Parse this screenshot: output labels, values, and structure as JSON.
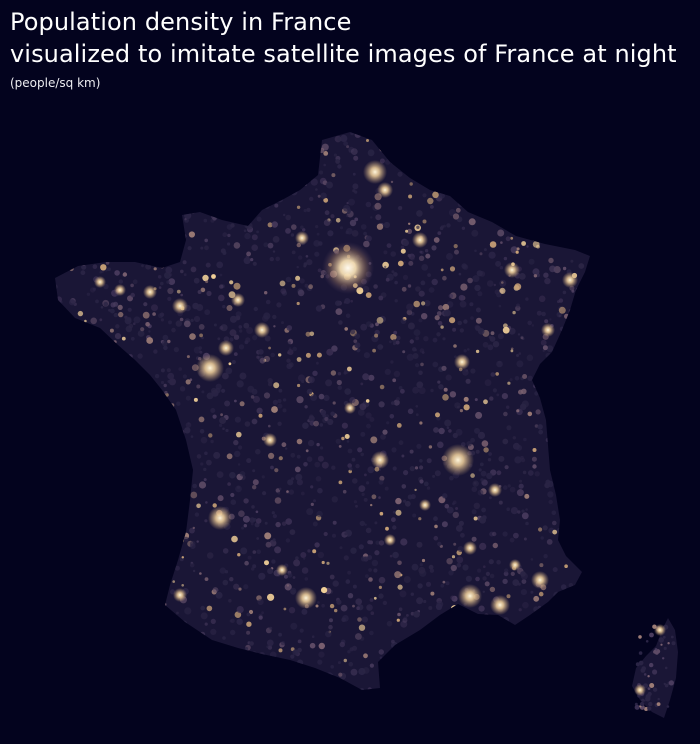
{
  "title": {
    "line1": "Population density in France",
    "line2": "visualized to imitate satellite images of France at night",
    "unit": "(people/sq km)"
  },
  "colors": {
    "background": "#03031e",
    "land_base": "#1a1636",
    "light_low": "#5a4a6a",
    "light_mid": "#c9a277",
    "light_high": "#fff3d6"
  },
  "map": {
    "region": "France (metropolitan)",
    "encoding": "population density per commune rendered as light intensity"
  }
}
